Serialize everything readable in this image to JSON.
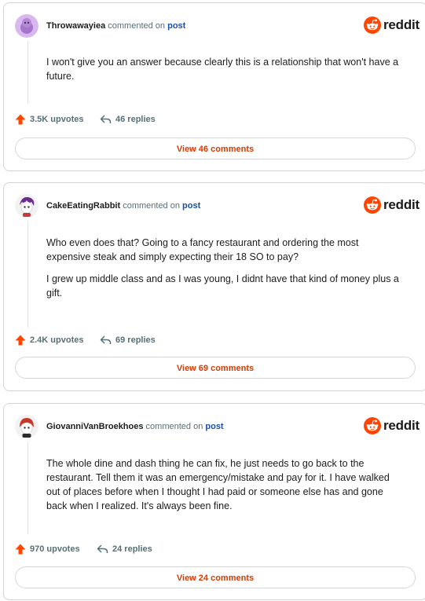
{
  "brand": {
    "wordmark": "reddit",
    "color": "#ff4500"
  },
  "comments": [
    {
      "username": "Throwawayiea",
      "commented_text": "commented on",
      "post_link": "post",
      "paragraphs": [
        "I won't give you an answer because clearly this is a relationship that won't have a future."
      ],
      "upvotes": "3.5K upvotes",
      "replies": "46 replies",
      "view_button": "View 46 comments",
      "avatar": "snoo-avatar-purple"
    },
    {
      "username": "CakeEatingRabbit",
      "commented_text": "commented on",
      "post_link": "post",
      "paragraphs": [
        "Who even does that? Going to a fancy restaurant and ordering the most expensive steak and simply expecting their 18 SO to pay?",
        "I grew up middle class and as I was young, I didnt have that kind of money plus a gift."
      ],
      "upvotes": "2.4K upvotes",
      "replies": "69 replies",
      "view_button": "View 69 comments",
      "avatar": "snoo-avatar-purple-hair"
    },
    {
      "username": "GiovanniVanBroekhoes",
      "commented_text": "commented on",
      "post_link": "post",
      "paragraphs": [
        "The whole dine and dash thing he can fix, he just needs to go back to the restaurant. Tell them it was an emergency/mistake and pay for it. I have walked out of places before when I thought I had paid or someone else has and gone back when I realized. It's always been fine."
      ],
      "upvotes": "970 upvotes",
      "replies": "24 replies",
      "view_button": "View 24 comments",
      "avatar": "snoo-avatar-red-hair"
    }
  ]
}
